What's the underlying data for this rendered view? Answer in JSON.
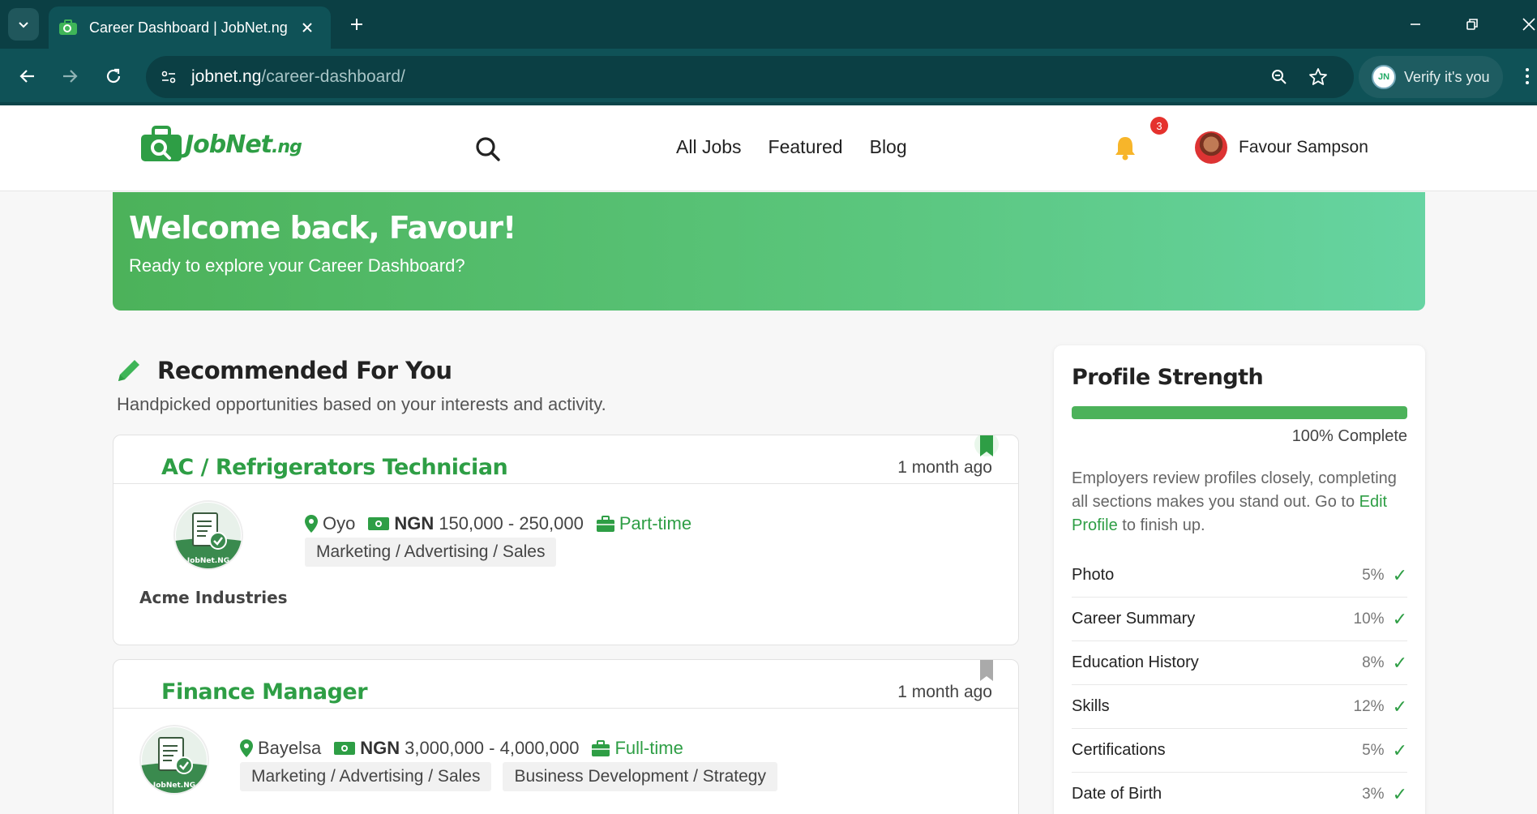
{
  "browser": {
    "tab_title": "Career Dashboard | JobNet.ng",
    "url_domain": "jobnet.ng",
    "url_path": "/career-dashboard/",
    "verify_label": "Verify it's you"
  },
  "header": {
    "logo_text": "JobNet",
    "logo_suffix": ".ng",
    "nav": [
      "All Jobs",
      "Featured",
      "Blog"
    ],
    "notification_count": "3",
    "user_name": "Favour Sampson"
  },
  "welcome": {
    "title": "Welcome back, Favour!",
    "subtitle": "Ready to explore your Career Dashboard?"
  },
  "recommended": {
    "title": "Recommended For You",
    "subtitle": "Handpicked opportunities based on your interests and activity.",
    "jobs": [
      {
        "title": "AC / Refrigerators Technician",
        "time": "1 month ago",
        "bookmarked": true,
        "company": "Acme Industries",
        "location": "Oyo",
        "currency": "NGN",
        "salary": "150,000 - 250,000",
        "type": "Part-time",
        "tags": [
          "Marketing / Advertising / Sales"
        ]
      },
      {
        "title": "Finance Manager",
        "time": "1 month ago",
        "bookmarked": false,
        "company": "",
        "location": "Bayelsa",
        "currency": "NGN",
        "salary": "3,000,000 - 4,000,000",
        "type": "Full-time",
        "tags": [
          "Marketing / Advertising / Sales",
          "Business Development / Strategy"
        ]
      }
    ]
  },
  "profile": {
    "title": "Profile Strength",
    "progress": 100,
    "progress_label": "100% Complete",
    "desc_before": "Employers review profiles closely, completing all sections makes you stand out. Go to ",
    "desc_link": "Edit Profile",
    "desc_after": " to finish up.",
    "items": [
      {
        "label": "Photo",
        "pct": "5%"
      },
      {
        "label": "Career Summary",
        "pct": "10%"
      },
      {
        "label": "Education History",
        "pct": "8%"
      },
      {
        "label": "Skills",
        "pct": "12%"
      },
      {
        "label": "Certifications",
        "pct": "5%"
      },
      {
        "label": "Date of Birth",
        "pct": "3%"
      }
    ]
  },
  "colors": {
    "brand_green": "#2e9e45",
    "chrome_dark": "#0b3f44",
    "chrome_toolbar": "#0f5257",
    "badge_red": "#e5322d"
  }
}
